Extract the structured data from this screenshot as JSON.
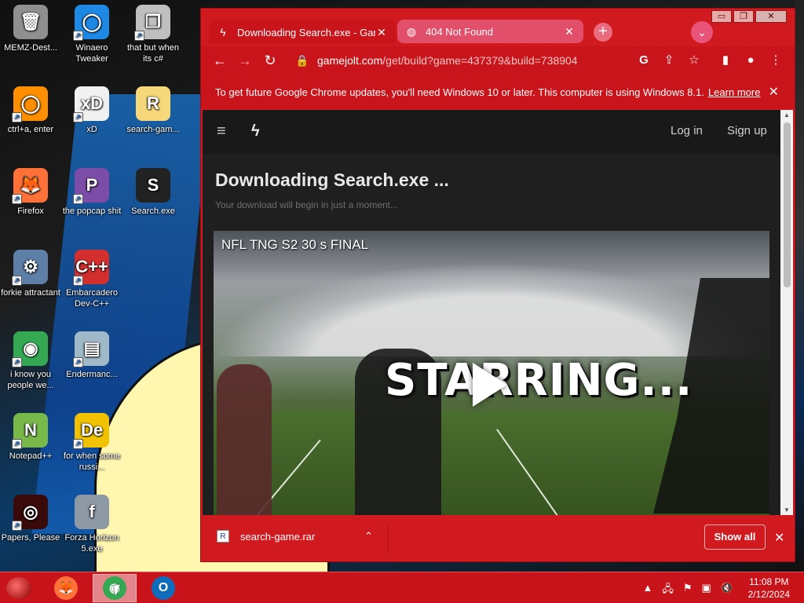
{
  "desktop": {
    "icons": [
      {
        "label": "MEMZ-Dest...",
        "glyph": "🗑",
        "bg": "#8f8f8f",
        "shortcut": false
      },
      {
        "label": "Winaero Tweaker",
        "glyph": "◯",
        "bg": "#1e88e5",
        "shortcut": true
      },
      {
        "label": "that but when its c#",
        "glyph": "❐",
        "bg": "#bfbfbf",
        "shortcut": true
      },
      {
        "label": "ctrl+a, enter",
        "glyph": "◯",
        "bg": "#ff8f00",
        "shortcut": true
      },
      {
        "label": "xD",
        "glyph": "xD",
        "bg": "#f1f1f1",
        "shortcut": true
      },
      {
        "label": "search-gam...",
        "glyph": "R",
        "bg": "#f6d77a",
        "shortcut": false
      },
      {
        "label": "Firefox",
        "glyph": "🦊",
        "bg": "#ff7139",
        "shortcut": true
      },
      {
        "label": "the popcap shit",
        "glyph": "P",
        "bg": "#7b4ca8",
        "shortcut": true
      },
      {
        "label": "Search.exe",
        "glyph": "S",
        "bg": "#222222",
        "shortcut": false
      },
      {
        "label": "forkie attractant",
        "glyph": "⚙",
        "bg": "#5e7fa8",
        "shortcut": true
      },
      {
        "label": "Embarcadero Dev-C++",
        "glyph": "C++",
        "bg": "#d32f2f",
        "shortcut": true
      },
      {
        "label": "i know you people we...",
        "glyph": "◉",
        "bg": "#34a853",
        "shortcut": true
      },
      {
        "label": "Endermanc...",
        "glyph": "▤",
        "bg": "#9fb9c9",
        "shortcut": true
      },
      {
        "label": "Notepad++",
        "glyph": "N",
        "bg": "#79b84a",
        "shortcut": true
      },
      {
        "label": "for when some russi...",
        "glyph": "De",
        "bg": "#f2c200",
        "shortcut": true
      },
      {
        "label": "Papers, Please",
        "glyph": "◎",
        "bg": "#3a0a0a",
        "shortcut": true
      },
      {
        "label": "Forza Horizon 5.exe",
        "glyph": "f",
        "bg": "#8e99a6",
        "shortcut": false
      }
    ]
  },
  "browser": {
    "window_controls": {
      "minimize": "▭",
      "restore": "❐",
      "close": "✕"
    },
    "tabs": [
      {
        "label": "Downloading Search.exe - Game",
        "icon": "ϟ",
        "close": "✕"
      },
      {
        "label": "404 Not Found",
        "icon": "◍",
        "close": "✕"
      }
    ],
    "new_tab": "+",
    "tab_search": "⌄",
    "nav": {
      "back": "←",
      "forward": "→",
      "reload": "↻"
    },
    "omnibox": {
      "lock": "🔒",
      "domain": "gamejolt.com",
      "path": "/get/build?game=437379&build=738904"
    },
    "toolbar_icons": {
      "google": "G",
      "share": "⇪",
      "star": "☆",
      "sidepanel": "▮",
      "profile": "●",
      "menu": "⋮"
    },
    "infobar": {
      "message": "To get future Google Chrome updates, you'll need Windows 10 or later. This computer is using Windows 8.1.",
      "link": "Learn more",
      "close": "✕"
    },
    "site": {
      "menu": "≡",
      "logo": "ϟ",
      "login": "Log in",
      "signup": "Sign up",
      "title": "Downloading Search.exe ...",
      "subtitle": "Your download will begin in just a moment...",
      "video_title": "NFL TNG S2 30 s FINAL",
      "video_overlay": "STARRING..."
    },
    "downloads": {
      "file": "search-game.rar",
      "file_icon": "R",
      "chevron": "⌃",
      "show_all": "Show all",
      "close": "✕"
    }
  },
  "taskbar": {
    "apps": [
      {
        "name": "firefox",
        "glyph": "🦊",
        "bg": "#ff7139",
        "active": false
      },
      {
        "name": "chrome",
        "glyph": "◉",
        "bg": "#34a853",
        "active": true
      },
      {
        "name": "outlook",
        "glyph": "O",
        "bg": "#0f6cbd",
        "active": false
      }
    ],
    "tray": {
      "chevron": "▲",
      "network_icon": "🖧",
      "flag": "⚑",
      "display": "▣",
      "volume": "🔇"
    },
    "time": "11:08 PM",
    "date": "2/12/2024"
  }
}
